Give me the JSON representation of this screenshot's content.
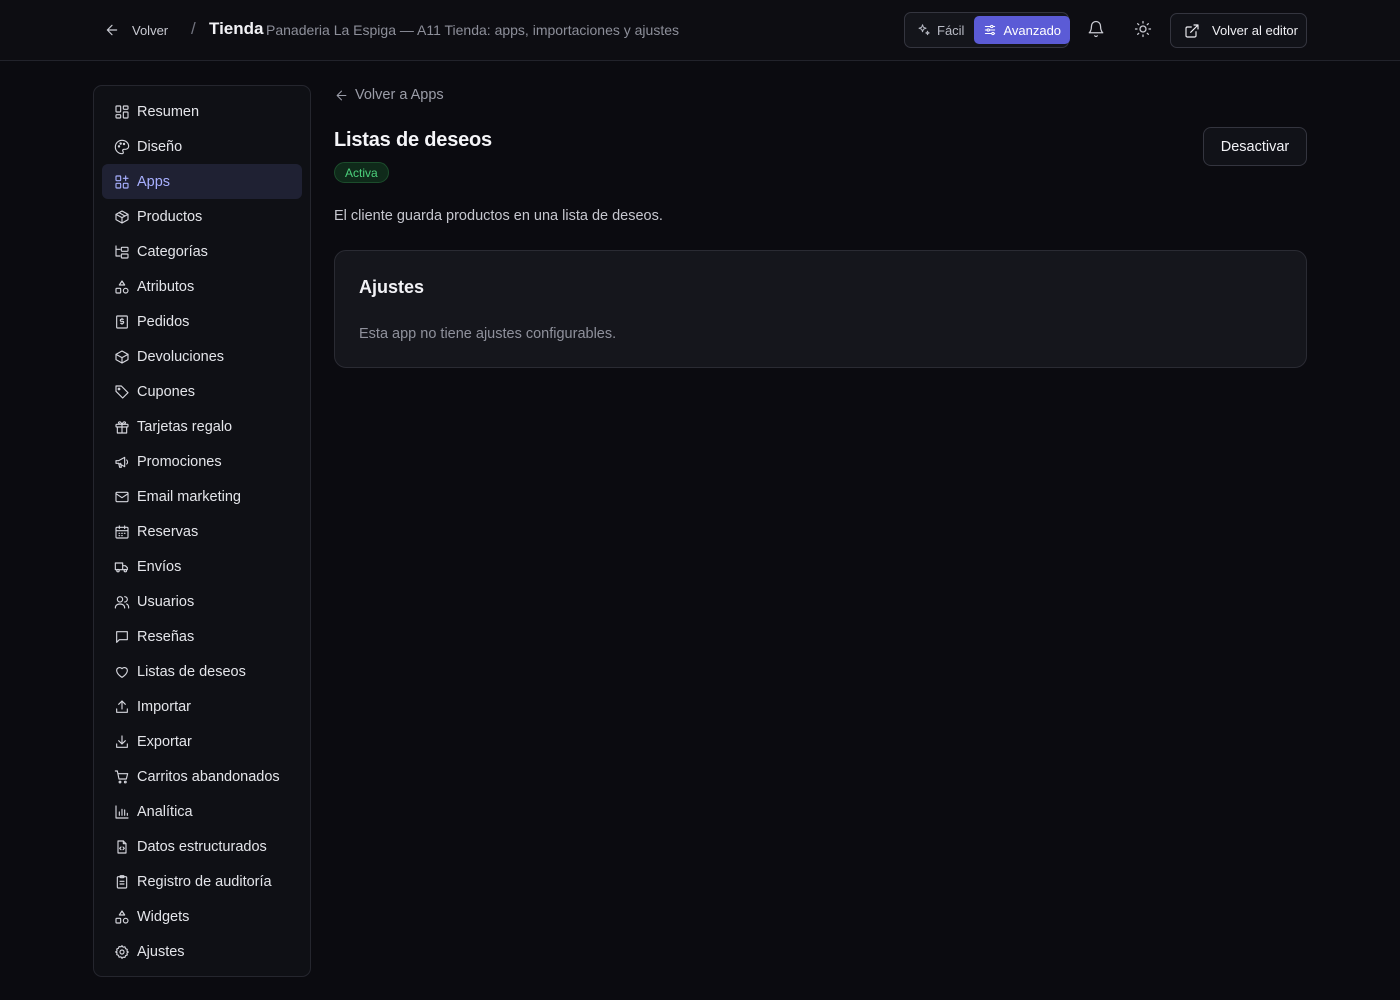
{
  "header": {
    "back_label": "Volver",
    "separator": "/",
    "brand": "Tienda",
    "subtitle": "Panaderia La Espiga — A11 Tienda: apps, importaciones y ajustes",
    "mode_easy": "Fácil",
    "mode_advanced": "Avanzado",
    "active_mode": "Avanzado",
    "editor_label": "Volver al editor"
  },
  "sidebar": {
    "active": "Apps",
    "items": [
      {
        "label": "Resumen",
        "icon": "dashboard-icon"
      },
      {
        "label": "Diseño",
        "icon": "palette-icon"
      },
      {
        "label": "Apps",
        "icon": "apps-icon"
      },
      {
        "label": "Productos",
        "icon": "package-icon"
      },
      {
        "label": "Categorías",
        "icon": "folder-tree-icon"
      },
      {
        "label": "Atributos",
        "icon": "shapes-icon"
      },
      {
        "label": "Pedidos",
        "icon": "receipt-icon"
      },
      {
        "label": "Devoluciones",
        "icon": "package-return-icon"
      },
      {
        "label": "Cupones",
        "icon": "tag-icon"
      },
      {
        "label": "Tarjetas regalo",
        "icon": "gift-icon"
      },
      {
        "label": "Promociones",
        "icon": "megaphone-icon"
      },
      {
        "label": "Email marketing",
        "icon": "mail-icon"
      },
      {
        "label": "Reservas",
        "icon": "calendar-icon"
      },
      {
        "label": "Envíos",
        "icon": "truck-icon"
      },
      {
        "label": "Usuarios",
        "icon": "users-icon"
      },
      {
        "label": "Reseñas",
        "icon": "message-square-icon"
      },
      {
        "label": "Listas de deseos",
        "icon": "heart-icon"
      },
      {
        "label": "Importar",
        "icon": "upload-icon"
      },
      {
        "label": "Exportar",
        "icon": "download-icon"
      },
      {
        "label": "Carritos abandonados",
        "icon": "cart-icon"
      },
      {
        "label": "Analítica",
        "icon": "bar-chart-icon"
      },
      {
        "label": "Datos estructurados",
        "icon": "file-code-icon"
      },
      {
        "label": "Registro de auditoría",
        "icon": "clipboard-icon"
      },
      {
        "label": "Widgets",
        "icon": "widgets-icon"
      },
      {
        "label": "Ajustes",
        "icon": "gear-icon"
      }
    ]
  },
  "main": {
    "back_link": "Volver a Apps",
    "title": "Listas de deseos",
    "status": "Activa",
    "deactivate_label": "Desactivar",
    "description": "El cliente guarda productos en una lista de deseos.",
    "settings_card": {
      "title": "Ajustes",
      "text": "Esta app no tiene ajustes configurables."
    }
  },
  "colors": {
    "background": "#0b0b10",
    "accent": "#5b5bd6",
    "active_nav_text": "#a8b0ff",
    "status_green": "#4cd17c"
  }
}
